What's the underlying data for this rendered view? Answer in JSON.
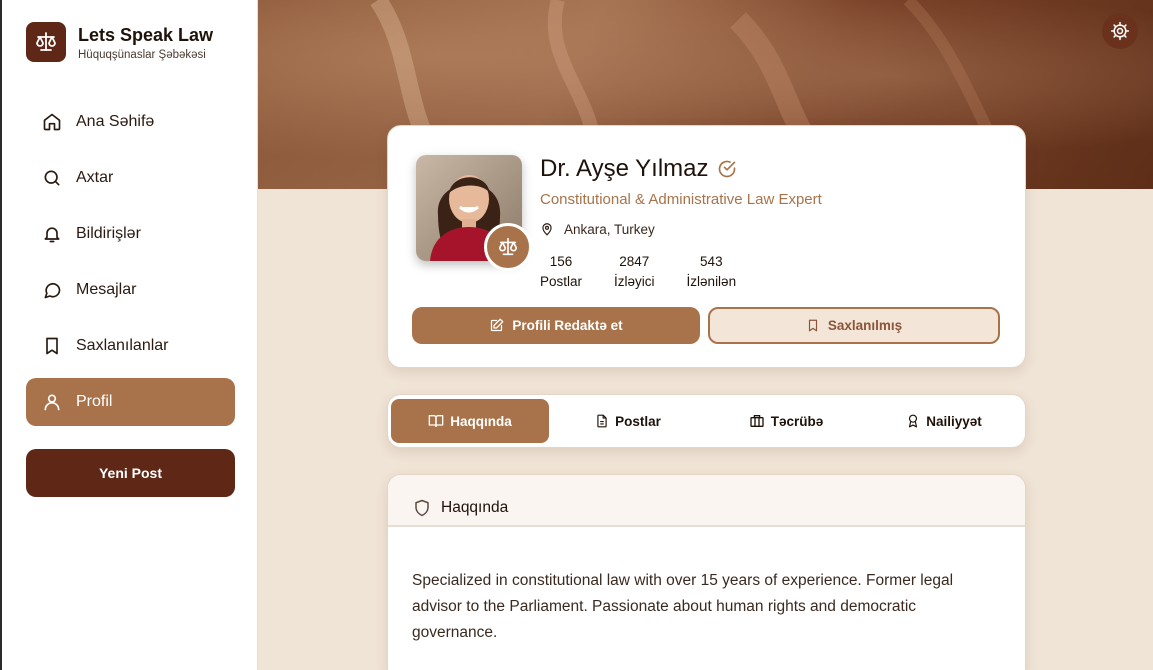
{
  "brand": {
    "title": "Lets Speak Law",
    "subtitle": "Hüquqşünaslar Şəbəkəsi",
    "logo_icon": "scales-icon",
    "color": "#5e2716"
  },
  "nav": {
    "items": [
      {
        "label": "Ana Səhifə",
        "icon": "home-icon"
      },
      {
        "label": "Axtar",
        "icon": "search-icon"
      },
      {
        "label": "Bildirişlər",
        "icon": "bell-icon"
      },
      {
        "label": "Mesajlar",
        "icon": "chat-icon"
      },
      {
        "label": "Saxlanılanlar",
        "icon": "bookmark-icon"
      },
      {
        "label": "Profil",
        "icon": "user-icon",
        "active": true
      }
    ],
    "new_post_label": "Yeni Post"
  },
  "profile": {
    "name": "Dr. Ayşe Yılmaz",
    "title": "Constitutional & Administrative Law Expert",
    "location": "Ankara, Turkey",
    "stats": [
      {
        "value": "156",
        "label": "Postlar"
      },
      {
        "value": "2847",
        "label": "İzləyici"
      },
      {
        "value": "543",
        "label": "İzlənilən"
      }
    ],
    "edit_label": "Profili Redaktə et",
    "saved_label": "Saxlanılmış"
  },
  "tabs": [
    {
      "label": "Haqqında",
      "icon": "book-icon",
      "active": true
    },
    {
      "label": "Postlar",
      "icon": "document-icon"
    },
    {
      "label": "Təcrübə",
      "icon": "briefcase-icon"
    },
    {
      "label": "Nailiyyət",
      "icon": "award-icon"
    }
  ],
  "about": {
    "heading": "Haqqında",
    "text": "Specialized in constitutional law with over 15 years of experience. Former legal advisor to the Parliament. Passionate about human rights and democratic governance."
  },
  "colors": {
    "accent": "#a8734a",
    "dark": "#5e2716",
    "background": "#f0e4d6"
  }
}
